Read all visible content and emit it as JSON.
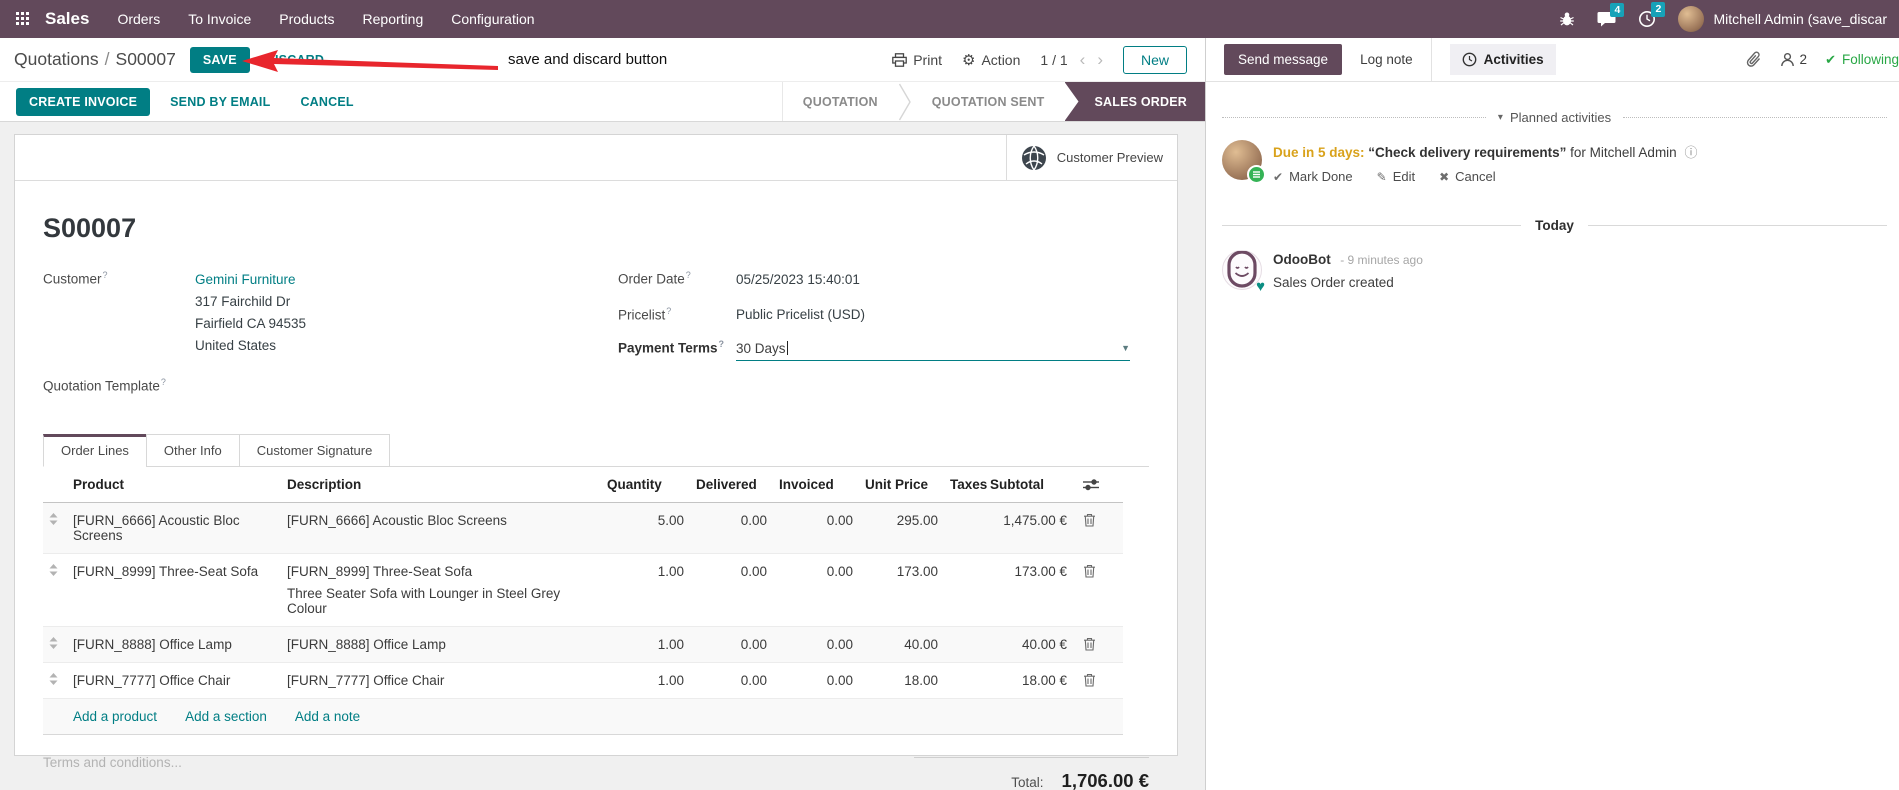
{
  "colors": {
    "brand_purple": "#62495B",
    "accent_teal": "#017E84",
    "badge_teal": "#17A2B8",
    "due_orange": "#D9A21B",
    "following_green": "#28A745",
    "highlight_blue": "#0C77B8",
    "annotation_red": "#E8262D"
  },
  "icons": {
    "gear": "⚙",
    "prev": "‹",
    "next": "›",
    "dropdown": "▼",
    "caret_down": "▾",
    "check": "✔",
    "pencil": "✎",
    "x": "✖",
    "info": "ⓘ",
    "heart": "♥"
  },
  "navbar": {
    "app_name": "Sales",
    "menus": [
      "Orders",
      "To Invoice",
      "Products",
      "Reporting",
      "Configuration"
    ],
    "systray": {
      "messages_badge": "4",
      "activities_badge": "2",
      "user_name": "Mitchell Admin (save_discar"
    }
  },
  "control_panel": {
    "breadcrumb_parent": "Quotations",
    "breadcrumb_sep": "/",
    "breadcrumb_current": "S00007",
    "save": "SAVE",
    "discard": "DISCARD",
    "annotation": "save and discard button",
    "print": "Print",
    "action": "Action",
    "pager": "1 / 1",
    "new": "New"
  },
  "statusbar": {
    "create_invoice": "CREATE INVOICE",
    "send_by_email": "SEND BY EMAIL",
    "cancel": "CANCEL",
    "stages": [
      "QUOTATION",
      "QUOTATION SENT",
      "SALES ORDER"
    ]
  },
  "form": {
    "customer_preview": "Customer Preview",
    "name": "S00007",
    "customer": {
      "label": "Customer",
      "help": "?",
      "value": "Gemini Furniture",
      "address": [
        "317 Fairchild Dr",
        "Fairfield CA 94535",
        "United States"
      ]
    },
    "quotation_template": {
      "label": "Quotation Template",
      "help": "?",
      "value": ""
    },
    "order_date": {
      "label": "Order Date",
      "help": "?",
      "value": "05/25/2023 15:40:01"
    },
    "pricelist": {
      "label": "Pricelist",
      "help": "?",
      "value": "Public Pricelist (USD)"
    },
    "payment_terms": {
      "label": "Payment Terms",
      "help": "?",
      "value": "30 Days"
    },
    "tabs": [
      "Order Lines",
      "Other Info",
      "Customer Signature"
    ],
    "order_lines": {
      "headers": {
        "product": "Product",
        "description": "Description",
        "quantity": "Quantity",
        "delivered": "Delivered",
        "invoiced": "Invoiced",
        "unit_price": "Unit Price",
        "taxes": "Taxes",
        "subtotal": "Subtotal"
      },
      "rows": [
        {
          "product": "[FURN_6666] Acoustic Bloc Screens",
          "description": "[FURN_6666] Acoustic Bloc Screens",
          "description2": "",
          "quantity": "5.00",
          "delivered": "0.00",
          "invoiced": "0.00",
          "unit_price": "295.00",
          "taxes": "",
          "subtotal": "1,475.00 €"
        },
        {
          "product": "[FURN_8999] Three-Seat Sofa",
          "description": "[FURN_8999] Three-Seat Sofa",
          "description2": "Three Seater Sofa with Lounger in Steel Grey Colour",
          "quantity": "1.00",
          "delivered": "0.00",
          "invoiced": "0.00",
          "unit_price": "173.00",
          "taxes": "",
          "subtotal": "173.00 €"
        },
        {
          "product": "[FURN_8888] Office Lamp",
          "description": "[FURN_8888] Office Lamp",
          "description2": "",
          "quantity": "1.00",
          "delivered": "0.00",
          "invoiced": "0.00",
          "unit_price": "40.00",
          "taxes": "",
          "subtotal": "40.00 €"
        },
        {
          "product": "[FURN_7777] Office Chair",
          "description": "[FURN_7777] Office Chair",
          "description2": "",
          "quantity": "1.00",
          "delivered": "0.00",
          "invoiced": "0.00",
          "unit_price": "18.00",
          "taxes": "",
          "subtotal": "18.00 €"
        }
      ],
      "add_product": "Add a product",
      "add_section": "Add a section",
      "add_note": "Add a note"
    },
    "terms_placeholder": "Terms and conditions...",
    "total_label": "Total:",
    "total_value": "1,706.00 €"
  },
  "chatter": {
    "send_message": "Send message",
    "log_note": "Log note",
    "activities": "Activities",
    "followers_count": "2",
    "following": "Following",
    "planned": {
      "title": "Planned activities",
      "due": "Due in 5 days:",
      "summary": "“Check delivery requirements”",
      "assignee": "for Mitchell Admin",
      "mark_done": "Mark Done",
      "edit": "Edit",
      "cancel": "Cancel"
    },
    "today_label": "Today",
    "message": {
      "author": "OdooBot",
      "time": "- 9 minutes ago",
      "body": "Sales Order created"
    }
  }
}
